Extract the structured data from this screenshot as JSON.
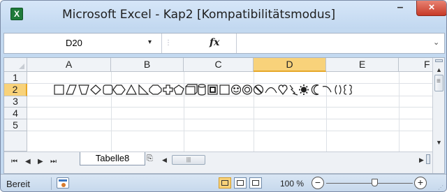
{
  "window": {
    "title": "Microsoft Excel - Kap2  [Kompatibilitätsmodus]",
    "app_icon_letter": "X",
    "minimize": "–",
    "close": "×"
  },
  "formula_bar": {
    "name_box": "D20",
    "name_box_arrow": "▾",
    "fx_label": "fx",
    "formula": "",
    "expand": "⌄"
  },
  "grid": {
    "columns": [
      "A",
      "B",
      "C",
      "D",
      "E",
      "F"
    ],
    "rows": [
      "1",
      "2",
      "3",
      "4",
      "5"
    ],
    "active_column": "D",
    "active_row": "2"
  },
  "sheet_tabs": {
    "tabs": [
      "Tabelle8"
    ],
    "nav": [
      "⏮",
      "◀",
      "▶",
      "⏭"
    ],
    "insert_tab": "⎘"
  },
  "status_bar": {
    "ready": "Bereit",
    "zoom": "100 %",
    "zoom_out": "−",
    "zoom_in": "+"
  },
  "colors": {
    "accent": "#f8d27a",
    "window_chrome": "#c3d9f0",
    "close_button": "#c73a28",
    "excel_green": "#1f7a3a"
  }
}
